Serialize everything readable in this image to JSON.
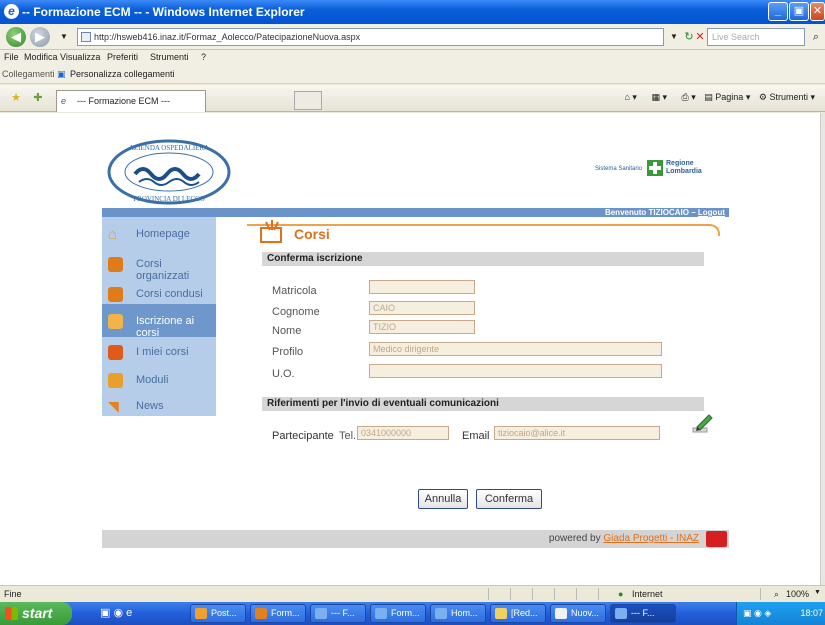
{
  "window": {
    "title": "-- Formazione ECM -- - Windows Internet Explorer"
  },
  "browser": {
    "url": "http://hsweb416.inaz.it/Formaz_Aolecco/PatecipazioneNuova.aspx",
    "search_placeholder": "Live Search",
    "menu": [
      "File",
      "Modifica",
      "Visualizza",
      "Preferiti",
      "Strumenti",
      "?"
    ],
    "favorites_bar": {
      "label": "Collegamenti",
      "item": "Personalizza collegamenti"
    },
    "tab_title": "--- Formazione ECM ---",
    "commands": {
      "page": "Pagina",
      "tools": "Strumenti"
    },
    "status": {
      "left": "Fine",
      "zone": "Internet",
      "zoom": "100%"
    }
  },
  "header": {
    "logo_text_top": "AZIENDA OSPEDALIERA",
    "logo_text_bottom": "PROVINCIA DI LECCO",
    "regione_left": "Sistema Sanitario",
    "regione_right_1": "Regione",
    "regione_right_2": "Lombardia",
    "welcome_prefix": "Benvenuto",
    "welcome_user": "TIZIOCAIO",
    "logout": "Logout"
  },
  "sidebar": {
    "items": [
      {
        "label": "Homepage",
        "icon": "home-icon",
        "color": "#e8a02a"
      },
      {
        "label": "Corsi organizzati",
        "icon": "people-icon",
        "color": "#e07b1a"
      },
      {
        "label": "Corsi condusi",
        "icon": "people-icon",
        "color": "#e07b1a"
      },
      {
        "label": "Iscrizione ai corsi",
        "icon": "enroll-icon",
        "color": "#f2b34a"
      },
      {
        "label": "I miei corsi",
        "icon": "courses-icon",
        "color": "#e05a1a"
      },
      {
        "label": "Moduli",
        "icon": "forms-icon",
        "color": "#e8a02a"
      },
      {
        "label": "News",
        "icon": "rss-icon",
        "color": "#e8801a"
      }
    ]
  },
  "main": {
    "title": "Corsi",
    "section1": "Conferma iscrizione",
    "fields": {
      "matricola_label": "Matricola",
      "matricola_value": "",
      "cognome_label": "Cognome",
      "cognome_value": "CAIO",
      "nome_label": "Nome",
      "nome_value": "TIZIO",
      "profilo_label": "Profilo",
      "profilo_value": "Medico dirigente",
      "uo_label": "U.O.",
      "uo_value": ""
    },
    "section2": "Riferimenti per l'invio di eventuali comunicazioni",
    "contact": {
      "participant_label": "Partecipante",
      "tel_label": "Tel.",
      "tel_value": "0341000000",
      "email_label": "Email",
      "email_value": "tiziocaio@alice.it"
    },
    "buttons": {
      "cancel": "Annulla",
      "confirm": "Conferma"
    }
  },
  "footer": {
    "powered_prefix": "powered by",
    "powered_link": "Giada Progetti - INAZ"
  },
  "taskbar": {
    "start": "start",
    "buttons": [
      "Post...",
      "Form...",
      "--- F...",
      "Form...",
      "Hom...",
      "[Red...",
      "Nuov...",
      "--- F..."
    ],
    "clock": "18:07"
  }
}
